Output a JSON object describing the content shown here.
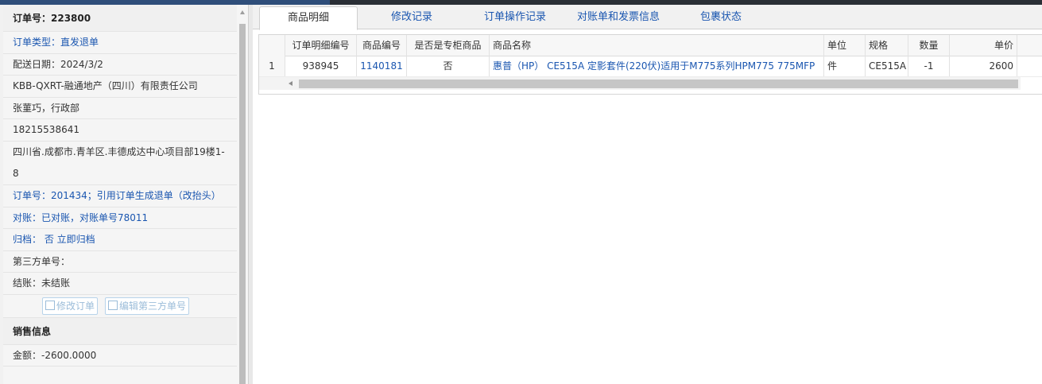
{
  "left": {
    "order_no_label": "订单号：223800",
    "order_type": "订单类型：直发退单",
    "delivery_date": "配送日期：2024/3/2",
    "company": "KBB-QXRT-融通地产（四川）有限责任公司",
    "contact": "张菫巧，行政部",
    "phone": "18215538641",
    "address": "四川省.成都市.青羊区.丰德成达中心项目部19楼1-8",
    "order_ref": "订单号：201434；引用订单生成退单（改抬头）",
    "reconcile": "对账：已对账，对账单号78011",
    "archive": "归档： 否 立即归档",
    "third_party": "第三方单号：",
    "settlement": "结账：未结账",
    "btn_modify": "修改订单",
    "btn_edit_third": "编辑第三方单号",
    "sales_header": "销售信息",
    "amount": "金额：-2600.0000"
  },
  "tabs": [
    {
      "label": "商品明细"
    },
    {
      "label": "修改记录"
    },
    {
      "label": "订单操作记录"
    },
    {
      "label": "对账单和发票信息"
    },
    {
      "label": "包裹状态"
    }
  ],
  "grid": {
    "headers": [
      "订单明细编号",
      "商品编号",
      "是否是专柜商品",
      "商品名称",
      "单位",
      "规格",
      "数量",
      "单价"
    ],
    "row": {
      "index": "1",
      "detail_no": "938945",
      "product_no": "1140181",
      "is_counter": "否",
      "name": "惠普（HP） CE515A 定影套件(220伏)适用于M775系列HPM775 775MFP",
      "unit": "件",
      "spec": "CE515A",
      "qty": "-1",
      "price": "2600"
    }
  }
}
